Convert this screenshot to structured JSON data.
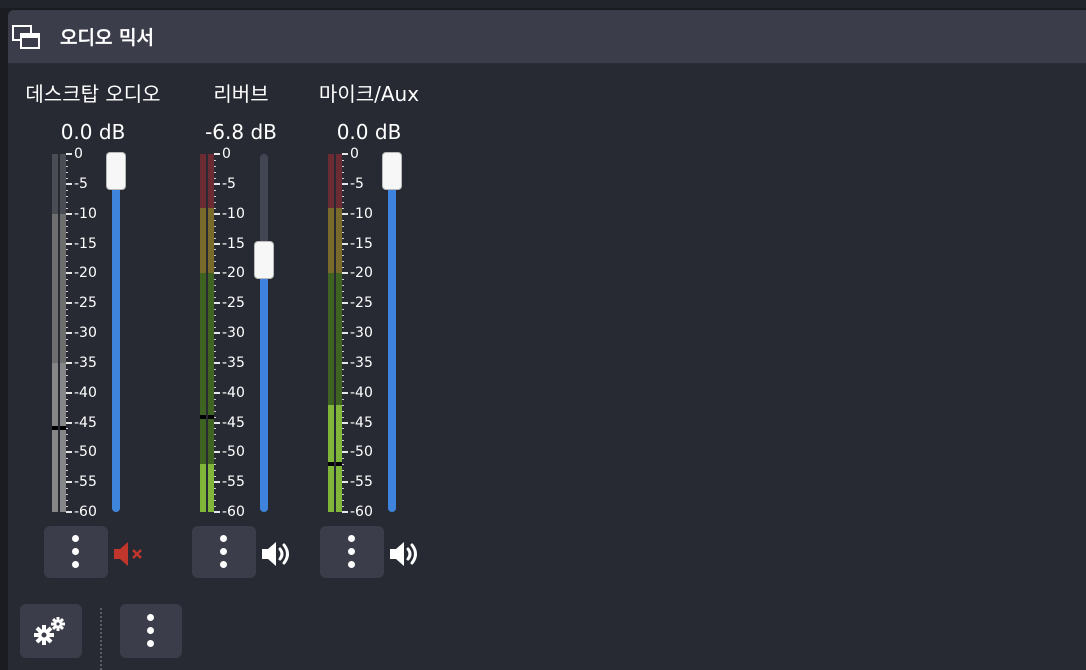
{
  "dock": {
    "title": "오디오 믹서",
    "title_bar_color": "#3b3e4a",
    "background_color": "#272a33"
  },
  "meter_scale": [
    "0",
    "-5",
    "-10",
    "-15",
    "-20",
    "-25",
    "-30",
    "-35",
    "-40",
    "-45",
    "-50",
    "-55",
    "-60"
  ],
  "channels": [
    {
      "name": "데스크탑 오디오",
      "volume_label": "0.0 dB",
      "fader_level_db": 0.0,
      "muted": true,
      "active": false,
      "meter_level_db": -35,
      "peak_db": -46,
      "mute_icon": "muted-speaker-icon",
      "menu_icon": "vertical-dots-icon"
    },
    {
      "name": "리버브",
      "volume_label": "-6.8 dB",
      "fader_level_db": -6.8,
      "muted": false,
      "active": true,
      "meter_level_db": -52,
      "peak_db": -44,
      "mute_icon": "speaker-icon",
      "menu_icon": "vertical-dots-icon"
    },
    {
      "name": "마이크/Aux",
      "volume_label": "0.0 dB",
      "fader_level_db": 0.0,
      "muted": false,
      "active": true,
      "meter_level_db": -42,
      "peak_db": -52,
      "mute_icon": "speaker-icon",
      "menu_icon": "vertical-dots-icon"
    }
  ],
  "footer": {
    "settings_icon": "gears-icon",
    "menu_icon": "vertical-dots-icon"
  },
  "colors": {
    "accent": "#3f84dc",
    "muted_icon": "#c0362c",
    "meter_red": "#6b2b33",
    "meter_yellow": "#7a6a2a",
    "meter_green": "#3f6320",
    "meter_green_active": "#8cc63f"
  }
}
